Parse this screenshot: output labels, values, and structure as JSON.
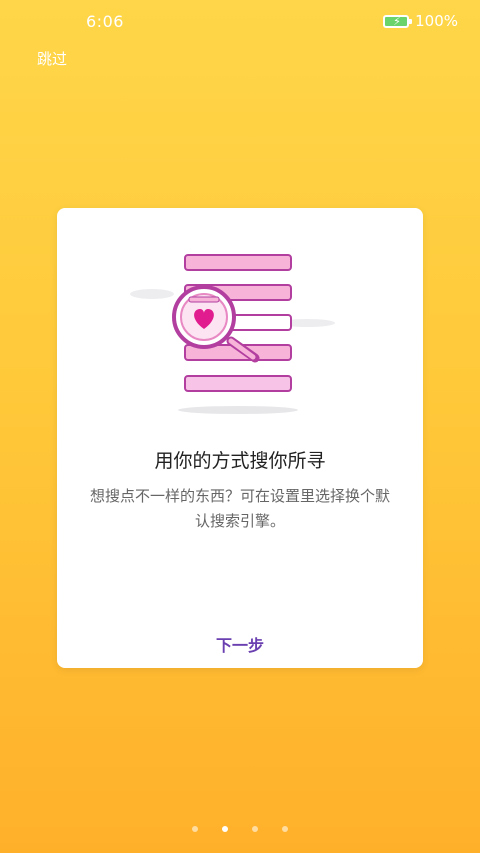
{
  "status_bar": {
    "time": "6:06",
    "battery_percent": "100%"
  },
  "skip_label": "跳过",
  "card": {
    "title": "用你的方式搜你所寻",
    "description": "想搜点不一样的东西？可在设置里选择换个默认搜索引擎。",
    "next_label": "下一步",
    "illustration": "magnifier-heart-list-icon"
  },
  "pager": {
    "count": 4,
    "active_index": 1
  },
  "colors": {
    "background_top": "#FFD649",
    "background_bottom": "#FFB02B",
    "accent_text": "#6A3FB0",
    "pink_bar": "#F7B3D8",
    "purple_border": "#B23FA0"
  }
}
